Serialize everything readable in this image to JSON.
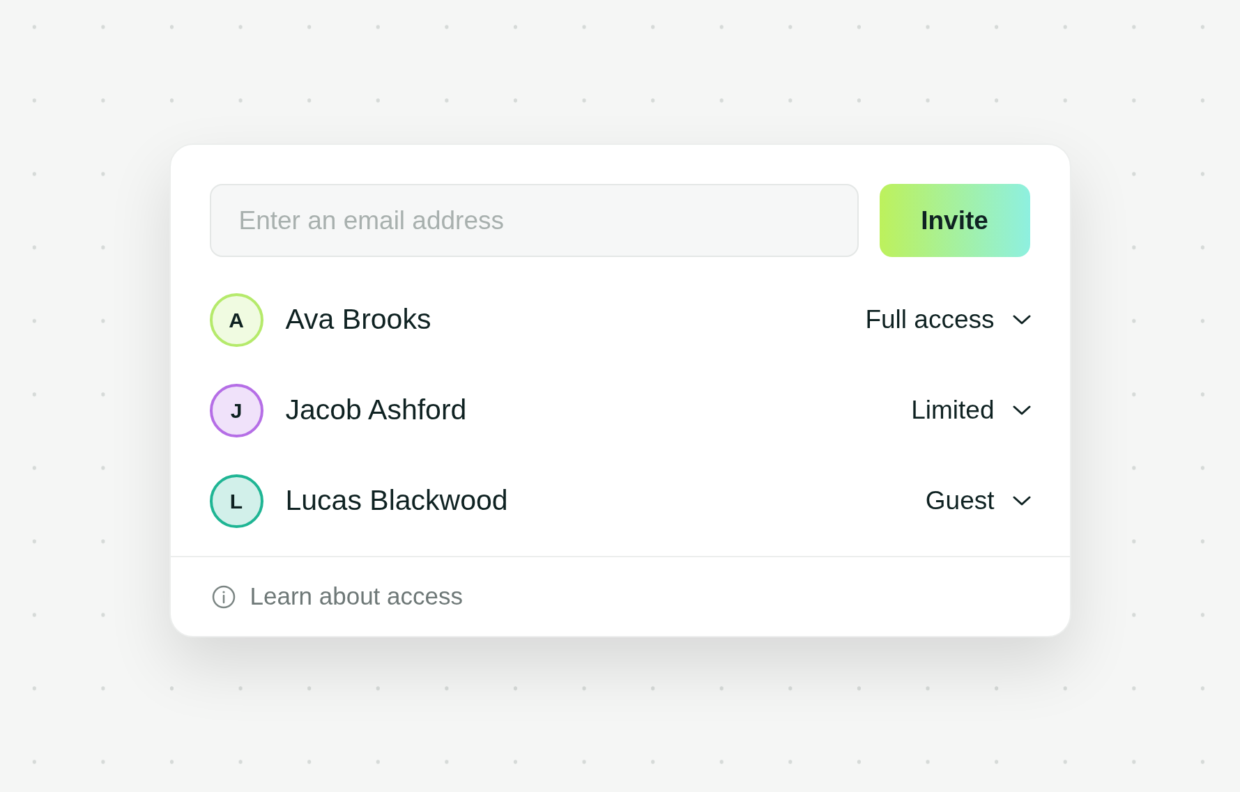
{
  "invite": {
    "placeholder": "Enter an email address",
    "button": "Invite"
  },
  "members": [
    {
      "initial": "A",
      "name": "Ava Brooks",
      "role": "Full access",
      "color": "#b5ea6b"
    },
    {
      "initial": "J",
      "name": "Jacob Ashford",
      "role": "Limited",
      "color": "#b56ee6"
    },
    {
      "initial": "L",
      "name": "Lucas Blackwood",
      "role": "Guest",
      "color": "#1fb594"
    }
  ],
  "footer": {
    "link": "Learn about access"
  }
}
